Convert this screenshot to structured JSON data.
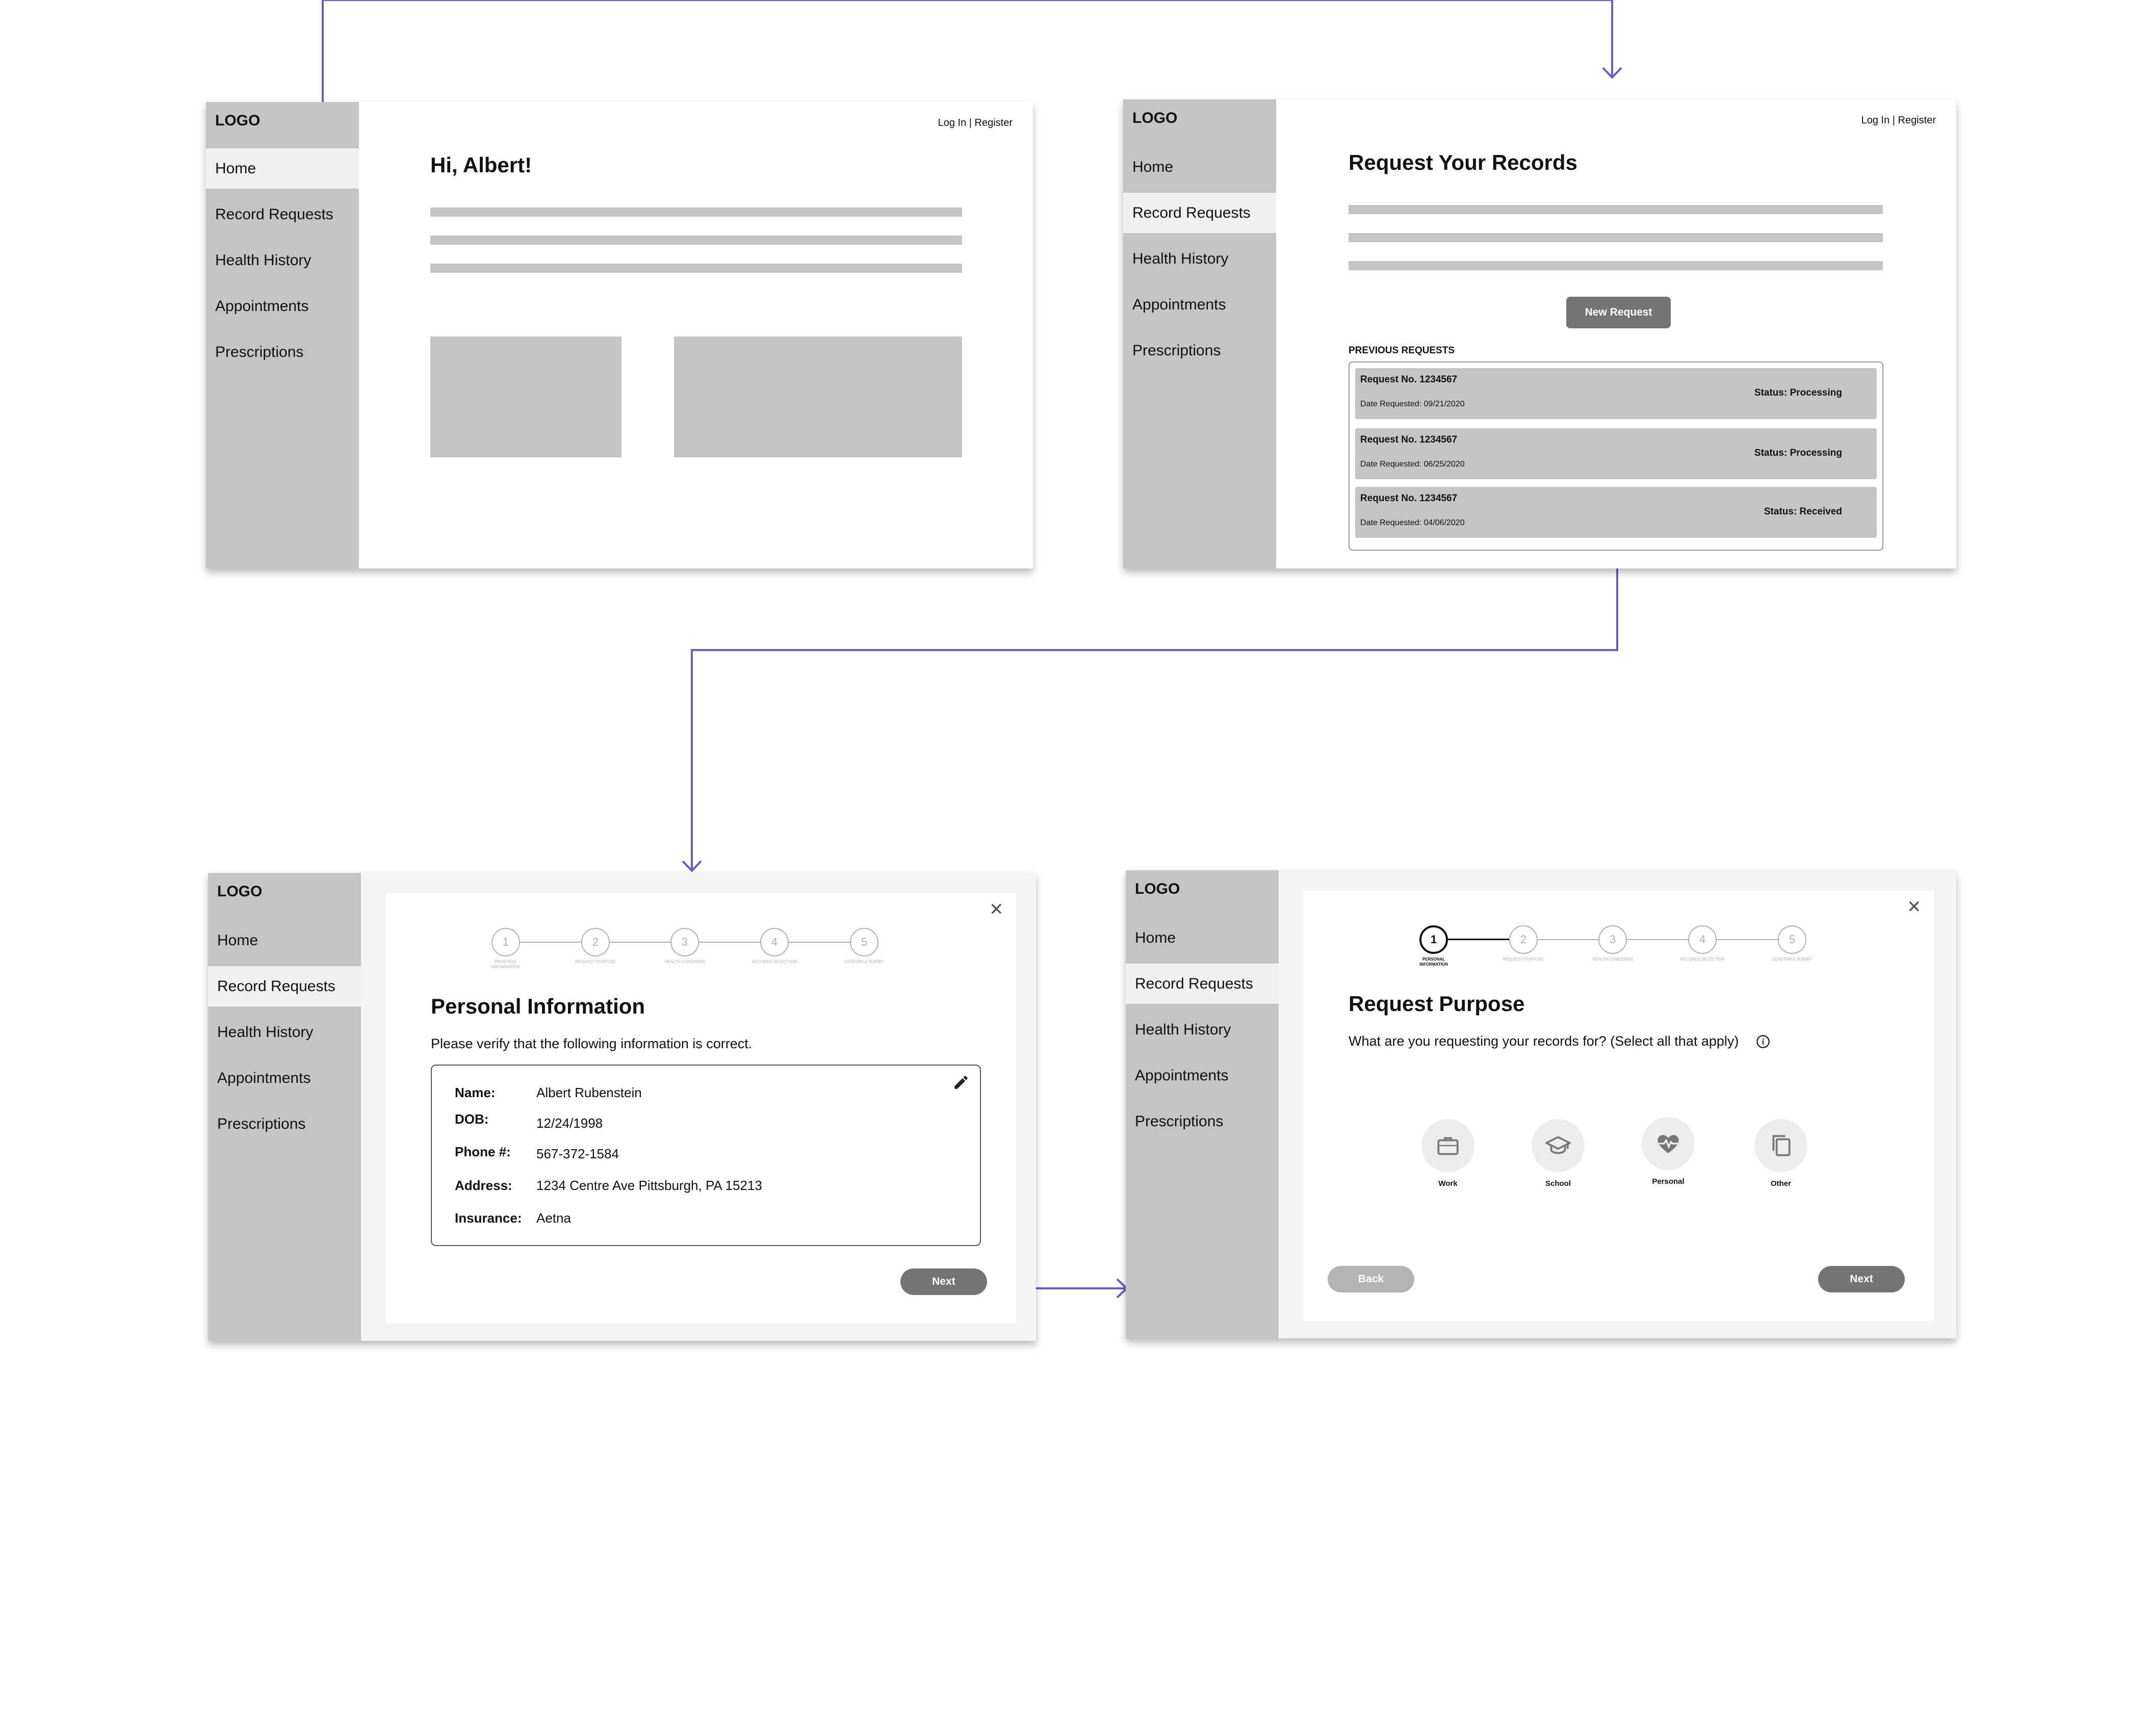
{
  "nav": {
    "logo": "LOGO",
    "items": [
      "Home",
      "Record Requests",
      "Health History",
      "Appointments",
      "Prescriptions"
    ]
  },
  "auth_link": "Log In | Register",
  "screen_home": {
    "greeting": "Hi, Albert!"
  },
  "screen_records": {
    "title": "Request Your Records",
    "new_request": "New Request",
    "previous_label": "PREVIOUS REQUESTS",
    "requests": [
      {
        "number": "Request No. 1234567",
        "date": "Date Requested: 09/21/2020",
        "status": "Status: Processing"
      },
      {
        "number": "Request No. 1234567",
        "date": "Date Requested: 06/25/2020",
        "status": "Status: Processing"
      },
      {
        "number": "Request No. 1234567",
        "date": "Date Requested: 04/06/2020",
        "status": "Status: Received"
      }
    ]
  },
  "stepper": {
    "numbers": [
      "1",
      "2",
      "3",
      "4",
      "5"
    ],
    "labels": [
      "PERSONAL INFORMATION",
      "REQUEST PURPOSE",
      "HEALTH CONCERNS",
      "RECORDS SELECTION",
      "CONFIRM & SUBMIT"
    ]
  },
  "screen_personal": {
    "title": "Personal Information",
    "subtitle": "Please verify that the following information is correct.",
    "fields": [
      {
        "label": "Name:",
        "value": "Albert Rubenstein"
      },
      {
        "label": "DOB:",
        "value": "12/24/1998"
      },
      {
        "label": "Phone #:",
        "value": "567-372-1584"
      },
      {
        "label": "Address:",
        "value": "1234 Centre Ave Pittsburgh, PA 15213"
      },
      {
        "label": "Insurance:",
        "value": "Aetna"
      }
    ],
    "next": "Next"
  },
  "screen_purpose": {
    "title": "Request Purpose",
    "question": "What are you requesting your records for? (Select all that apply)",
    "options": [
      "Work",
      "School",
      "Personal",
      "Other"
    ],
    "back": "Back",
    "next": "Next"
  },
  "colors": {
    "connector": "#6a5acd",
    "sidebar": "#c4c4c4",
    "button": "#747474"
  }
}
